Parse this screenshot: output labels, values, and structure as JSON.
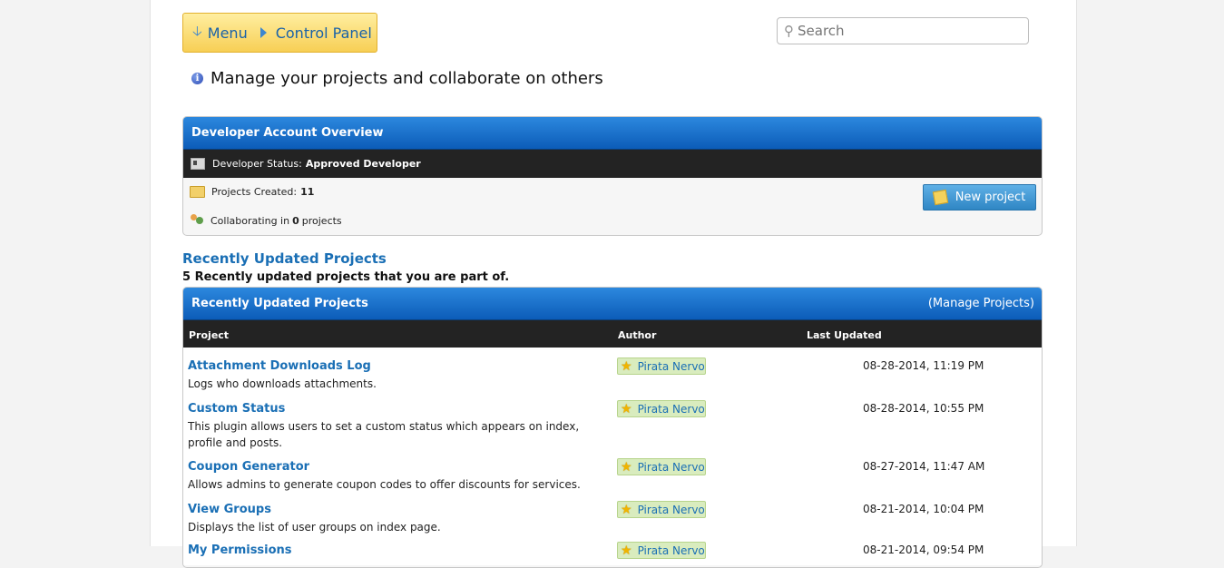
{
  "breadcrumb": {
    "menu": "Menu",
    "control_panel": "Control Panel"
  },
  "search": {
    "placeholder": "Search"
  },
  "intro": {
    "text": "Manage your projects and collaborate on others"
  },
  "overview": {
    "title": "Developer Account Overview",
    "status_label": "Developer Status:",
    "status_value": "Approved Developer",
    "projects_label": "Projects Created:",
    "projects_value": "11",
    "collab_prefix": "Collaborating in",
    "collab_value": "0",
    "collab_suffix": "projects",
    "new_project": "New project"
  },
  "recent": {
    "title": "Recently Updated Projects",
    "subtitle": "5 Recently updated projects that you are part of.",
    "panel_title": "Recently Updated Projects",
    "manage_link": "(Manage Projects)",
    "columns": {
      "project": "Project",
      "author": "Author",
      "updated": "Last Updated"
    },
    "rows": [
      {
        "title": "Attachment Downloads Log",
        "desc": "Logs who downloads attachments.",
        "author": "Pirata Nervo",
        "date": "08-28-2014, 11:19 PM"
      },
      {
        "title": "Custom Status",
        "desc": "This plugin allows users to set a custom status which appears on index, profile and posts.",
        "author": "Pirata Nervo",
        "date": "08-28-2014, 10:55 PM"
      },
      {
        "title": "Coupon Generator",
        "desc": "Allows admins to generate coupon codes to offer discounts for services.",
        "author": "Pirata Nervo",
        "date": "08-27-2014, 11:47 AM"
      },
      {
        "title": "View Groups",
        "desc": "Displays the list of user groups on index page.",
        "author": "Pirata Nervo",
        "date": "08-21-2014, 10:04 PM"
      },
      {
        "title": "My Permissions",
        "desc": "",
        "author": "Pirata Nervo",
        "date": "08-21-2014, 09:54 PM"
      }
    ]
  }
}
